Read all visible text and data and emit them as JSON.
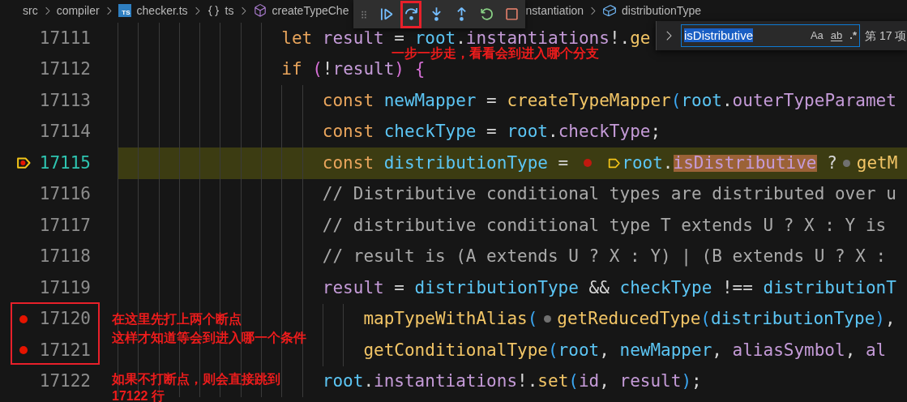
{
  "breadcrumbs": {
    "before": [
      {
        "label": "src"
      },
      {
        "label": "compiler"
      },
      {
        "kind": "file",
        "label": "checker.ts",
        "badge": "TS"
      },
      {
        "kind": "namespace",
        "label": "ts"
      },
      {
        "kind": "method",
        "label": "createTypeChe"
      }
    ],
    "after": [
      {
        "label": "nstantiation"
      },
      {
        "kind": "field",
        "label": "distributionType"
      }
    ]
  },
  "debug_toolbar": {
    "buttons": [
      {
        "kind": "continue",
        "boxed": false
      },
      {
        "kind": "step-over",
        "boxed": true
      },
      {
        "kind": "step-into",
        "boxed": false
      },
      {
        "kind": "step-out",
        "boxed": false
      },
      {
        "kind": "restart",
        "boxed": false
      },
      {
        "kind": "stop",
        "boxed": false
      }
    ]
  },
  "find_widget": {
    "value": "isDistributive",
    "options": [
      {
        "kind": "case",
        "label": "Aa"
      },
      {
        "kind": "word",
        "label": "ab"
      },
      {
        "kind": "regex",
        "label": ".*"
      }
    ],
    "result": "第 17 项"
  },
  "lines": [
    {
      "number": "17111",
      "current": false,
      "breakpoint": false,
      "boxed": false,
      "tokens": [
        {
          "kind": "keyword",
          "t": "let "
        },
        {
          "kind": "property",
          "t": "result"
        },
        {
          "kind": "punctuation",
          "t": " = "
        },
        {
          "kind": "variable",
          "t": "root"
        },
        {
          "kind": "punctuation",
          "t": "."
        },
        {
          "kind": "property",
          "t": "instantiations"
        },
        {
          "kind": "punctuation",
          "t": "!."
        },
        {
          "kind": "function",
          "t": "ge"
        }
      ]
    },
    {
      "number": "17112",
      "current": false,
      "breakpoint": false,
      "boxed": false,
      "tokens": [
        {
          "kind": "keyword",
          "t": "if "
        },
        {
          "kind": "bracket-1",
          "t": "("
        },
        {
          "kind": "punctuation",
          "t": "!"
        },
        {
          "kind": "property",
          "t": "result"
        },
        {
          "kind": "bracket-1",
          "t": ") {"
        }
      ],
      "children": [
        {
          "number": "17113",
          "current": false,
          "breakpoint": false,
          "boxed": false,
          "tokens": [
            {
              "kind": "keyword",
              "t": "const "
            },
            {
              "kind": "variable",
              "t": "newMapper"
            },
            {
              "kind": "punctuation",
              "t": " = "
            },
            {
              "kind": "function",
              "t": "createTypeMapper"
            },
            {
              "kind": "bracket-2",
              "t": "("
            },
            {
              "kind": "variable",
              "t": "root"
            },
            {
              "kind": "punctuation",
              "t": "."
            },
            {
              "kind": "property",
              "t": "outerTypeParamet"
            }
          ]
        },
        {
          "number": "17114",
          "current": false,
          "breakpoint": false,
          "boxed": false,
          "tokens": [
            {
              "kind": "keyword",
              "t": "const "
            },
            {
              "kind": "variable",
              "t": "checkType"
            },
            {
              "kind": "punctuation",
              "t": " = "
            },
            {
              "kind": "variable",
              "t": "root"
            },
            {
              "kind": "punctuation",
              "t": "."
            },
            {
              "kind": "property",
              "t": "checkType"
            },
            {
              "kind": "punctuation",
              "t": ";"
            }
          ]
        },
        {
          "number": "17115",
          "current": true,
          "breakpoint": true,
          "boxed": false,
          "tokens": [
            {
              "kind": "keyword",
              "t": "const "
            },
            {
              "kind": "variable",
              "t": "distributionType"
            },
            {
              "kind": "punctuation",
              "t": " ="
            },
            {
              "kind": "inline-breakpoint"
            },
            {
              "kind": "inline-stop"
            },
            {
              "kind": "variable",
              "t": "root"
            },
            {
              "kind": "punctuation",
              "t": "."
            },
            {
              "kind": "find-match",
              "t": "isDistributive"
            },
            {
              "kind": "punctuation",
              "t": " ?"
            },
            {
              "kind": "inline-hint"
            },
            {
              "kind": "function",
              "t": "getM"
            }
          ]
        },
        {
          "number": "17116",
          "current": false,
          "breakpoint": false,
          "boxed": false,
          "tokens": [
            {
              "kind": "comment",
              "t": "// Distributive conditional types are distributed over u"
            }
          ]
        },
        {
          "number": "17117",
          "current": false,
          "breakpoint": false,
          "boxed": false,
          "tokens": [
            {
              "kind": "comment",
              "t": "// distributive conditional type T extends U ? X : Y is"
            }
          ]
        },
        {
          "number": "17118",
          "current": false,
          "breakpoint": false,
          "boxed": false,
          "tokens": [
            {
              "kind": "comment",
              "t": "// result is (A extends U ? X : Y) | (B extends U ? X :"
            }
          ]
        },
        {
          "number": "17119",
          "current": false,
          "breakpoint": false,
          "boxed": false,
          "tokens": [
            {
              "kind": "property",
              "t": "result"
            },
            {
              "kind": "punctuation",
              "t": " = "
            },
            {
              "kind": "variable",
              "t": "distributionType"
            },
            {
              "kind": "punctuation",
              "t": " && "
            },
            {
              "kind": "variable",
              "t": "checkType"
            },
            {
              "kind": "punctuation",
              "t": " !== "
            },
            {
              "kind": "variable",
              "t": "distributionT"
            }
          ],
          "children": [
            {
              "number": "17120",
              "current": false,
              "breakpoint": true,
              "boxed": true,
              "tokens": [
                {
                  "kind": "function",
                  "t": "mapTypeWithAlias"
                },
                {
                  "kind": "bracket-2",
                  "t": "("
                },
                {
                  "kind": "inline-hint"
                },
                {
                  "kind": "function",
                  "t": "getReducedType"
                },
                {
                  "kind": "bracket-2",
                  "t": "("
                },
                {
                  "kind": "variable",
                  "t": "distributionType"
                },
                {
                  "kind": "bracket-2",
                  "t": ")"
                },
                {
                  "kind": "punctuation",
                  "t": ","
                }
              ]
            },
            {
              "number": "17121",
              "current": false,
              "breakpoint": true,
              "boxed": true,
              "tokens": [
                {
                  "kind": "function",
                  "t": "getConditionalType"
                },
                {
                  "kind": "bracket-2",
                  "t": "("
                },
                {
                  "kind": "variable",
                  "t": "root"
                },
                {
                  "kind": "punctuation",
                  "t": ", "
                },
                {
                  "kind": "variable",
                  "t": "newMapper"
                },
                {
                  "kind": "punctuation",
                  "t": ", "
                },
                {
                  "kind": "property",
                  "t": "aliasSymbol"
                },
                {
                  "kind": "punctuation",
                  "t": ", "
                },
                {
                  "kind": "property",
                  "t": "al"
                }
              ]
            }
          ]
        },
        {
          "number": "17122",
          "current": false,
          "breakpoint": false,
          "boxed": false,
          "tokens": [
            {
              "kind": "variable",
              "t": "root"
            },
            {
              "kind": "punctuation",
              "t": "."
            },
            {
              "kind": "property",
              "t": "instantiations"
            },
            {
              "kind": "punctuation",
              "t": "!."
            },
            {
              "kind": "function",
              "t": "set"
            },
            {
              "kind": "bracket-2",
              "t": "("
            },
            {
              "kind": "property",
              "t": "id"
            },
            {
              "kind": "punctuation",
              "t": ", "
            },
            {
              "kind": "property",
              "t": "result"
            },
            {
              "kind": "bracket-2",
              "t": ")"
            },
            {
              "kind": "punctuation",
              "t": ";"
            }
          ]
        }
      ]
    }
  ],
  "annotations": [
    {
      "kind": "toolbar-note",
      "lines": [
        "一步一步走，看看会到进入哪个分支"
      ]
    },
    {
      "kind": "breakpoint-note",
      "lines": [
        "在这里先打上两个断点",
        "这样才知道等会到进入哪一个条件"
      ]
    },
    {
      "kind": "skip-note",
      "lines": [
        "如果不打断点，则会直接跳到",
        "17122 行"
      ]
    }
  ]
}
